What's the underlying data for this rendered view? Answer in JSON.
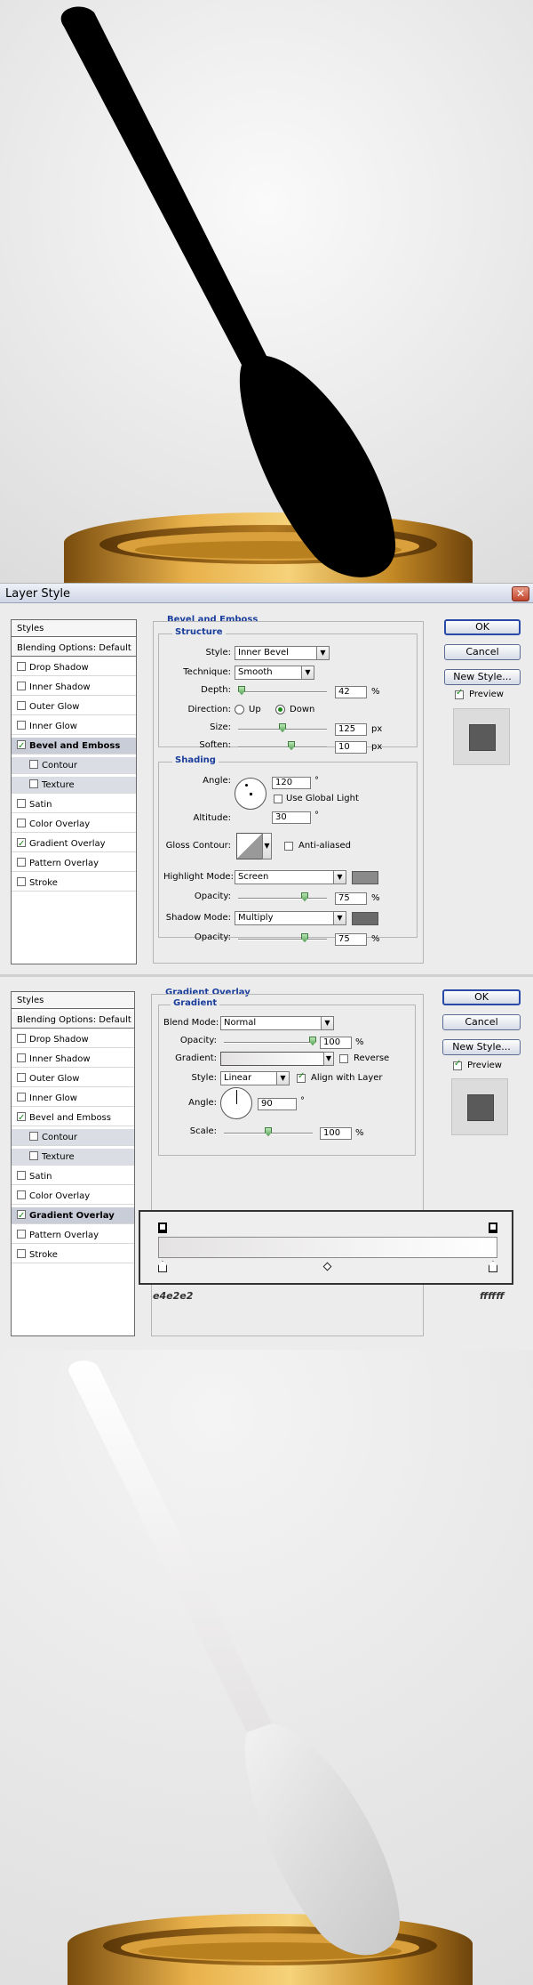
{
  "bevel_dialog": {
    "title": "Layer Style",
    "close_glyph": "✕",
    "styles_header": "Styles",
    "blending": "Blending Options: Default",
    "items": [
      {
        "label": "Drop Shadow",
        "checked": false
      },
      {
        "label": "Inner Shadow",
        "checked": false
      },
      {
        "label": "Outer Glow",
        "checked": false
      },
      {
        "label": "Inner Glow",
        "checked": false
      },
      {
        "label": "Bevel and Emboss",
        "checked": true,
        "selected": true
      },
      {
        "label": "Contour",
        "checked": false,
        "sub": true
      },
      {
        "label": "Texture",
        "checked": false,
        "sub": true
      },
      {
        "label": "Satin",
        "checked": false
      },
      {
        "label": "Color Overlay",
        "checked": false
      },
      {
        "label": "Gradient Overlay",
        "checked": true
      },
      {
        "label": "Pattern Overlay",
        "checked": false
      },
      {
        "label": "Stroke",
        "checked": false
      }
    ],
    "section_title": "Bevel and Emboss",
    "structure_title": "Structure",
    "style_label": "Style:",
    "style_value": "Inner Bevel",
    "technique_label": "Technique:",
    "technique_value": "Smooth",
    "depth_label": "Depth:",
    "depth_value": "42",
    "depth_level": 0.04,
    "pct": "%",
    "direction_label": "Direction:",
    "dir_up": "Up",
    "dir_down": "Down",
    "size_label": "Size:",
    "size_value": "125",
    "size_level": 0.5,
    "px": "px",
    "soften_label": "Soften:",
    "soften_value": "10",
    "soften_level": 0.6,
    "shading_title": "Shading",
    "angle_label": "Angle:",
    "angle_value": "120",
    "deg": "°",
    "global_light": "Use Global Light",
    "altitude_label": "Altitude:",
    "altitude_value": "30",
    "gloss_label": "Gloss Contour:",
    "anti_aliased": "Anti-aliased",
    "highlight_label": "Highlight Mode:",
    "highlight_value": "Screen",
    "highlight_color": "#8a8a8a",
    "h_opacity_label": "Opacity:",
    "h_opacity_value": "75",
    "h_opacity_level": 0.75,
    "shadow_label": "Shadow Mode:",
    "shadow_value": "Multiply",
    "shadow_color": "#6a6a6a",
    "s_opacity_label": "Opacity:",
    "s_opacity_value": "75",
    "s_opacity_level": 0.75,
    "ok": "OK",
    "cancel": "Cancel",
    "new_style": "New Style...",
    "preview": "Preview"
  },
  "gradient_dialog": {
    "styles_header": "Styles",
    "blending": "Blending Options: Default",
    "items": [
      {
        "label": "Drop Shadow",
        "checked": false
      },
      {
        "label": "Inner Shadow",
        "checked": false
      },
      {
        "label": "Outer Glow",
        "checked": false
      },
      {
        "label": "Inner Glow",
        "checked": false
      },
      {
        "label": "Bevel and Emboss",
        "checked": true
      },
      {
        "label": "Contour",
        "checked": false,
        "sub": true
      },
      {
        "label": "Texture",
        "checked": false,
        "sub": true
      },
      {
        "label": "Satin",
        "checked": false
      },
      {
        "label": "Color Overlay",
        "checked": false
      },
      {
        "label": "Gradient Overlay",
        "checked": true,
        "selected": true
      },
      {
        "label": "Pattern Overlay",
        "checked": false
      },
      {
        "label": "Stroke",
        "checked": false
      }
    ],
    "section_title": "Gradient Overlay",
    "gradient_title": "Gradient",
    "blend_label": "Blend Mode:",
    "blend_value": "Normal",
    "opacity_label": "Opacity:",
    "opacity_value": "100",
    "opacity_level": 1.0,
    "pct": "%",
    "gradient_label": "Gradient:",
    "reverse": "Reverse",
    "style_label": "Style:",
    "style_value": "Linear",
    "align": "Align with Layer",
    "angle_label": "Angle:",
    "angle_value": "90",
    "deg": "°",
    "scale_label": "Scale:",
    "scale_value": "100",
    "scale_level": 0.5,
    "ok": "OK",
    "cancel": "Cancel",
    "new_style": "New Style...",
    "preview": "Preview",
    "left_hex": "e4e2e2",
    "right_hex": "ffffff"
  },
  "colors": {
    "spoon_black": "#000000",
    "gold_dark": "#8a5a10",
    "gold_light": "#e8b04a",
    "bg_gray": "#e4e4e4"
  }
}
